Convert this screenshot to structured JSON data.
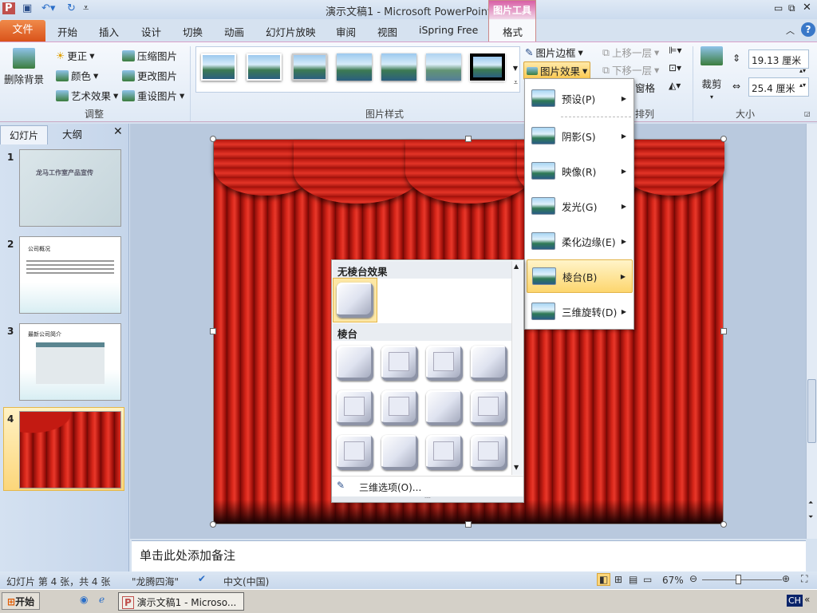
{
  "app": {
    "title": "演示文稿1 - Microsoft PowerPoint",
    "context_tab_group": "图片工具"
  },
  "tabs": {
    "file": "文件",
    "items": [
      "开始",
      "插入",
      "设计",
      "切换",
      "动画",
      "幻灯片放映",
      "审阅",
      "视图",
      "iSpring Free"
    ],
    "active": "格式"
  },
  "ribbon": {
    "remove_bg": "删除背景",
    "adjust": {
      "corrections": "更正",
      "color": "颜色",
      "artistic": "艺术效果",
      "compress": "压缩图片",
      "change": "更改图片",
      "reset": "重设图片",
      "label": "调整"
    },
    "styles": {
      "label": "图片样式",
      "border": "图片边框",
      "effects": "图片效果"
    },
    "arrange": {
      "forward": "上移一层",
      "backward": "下移一层",
      "pane": "窗格",
      "label": "排列"
    },
    "size": {
      "crop": "裁剪",
      "height": "19.13 厘米",
      "width": "25.4 厘米",
      "label": "大小"
    }
  },
  "panel": {
    "tabs": [
      "幻灯片",
      "大纲"
    ],
    "slides": [
      {
        "num": "1",
        "title": "龙马工作室产品宣传"
      },
      {
        "num": "2",
        "title": "公司概况"
      },
      {
        "num": "3",
        "title": "最新公司简介"
      },
      {
        "num": "4"
      }
    ]
  },
  "effects_menu": [
    {
      "label": "预设(P)"
    },
    {
      "label": "阴影(S)"
    },
    {
      "label": "映像(R)"
    },
    {
      "label": "发光(G)"
    },
    {
      "label": "柔化边缘(E)"
    },
    {
      "label": "棱台(B)",
      "highlighted": true
    },
    {
      "label": "三维旋转(D)"
    }
  ],
  "bevel_gallery": {
    "none_header": "无棱台效果",
    "bevel_header": "棱台",
    "options": "三维选项(O)...",
    "count": 12
  },
  "notes": "单击此处添加备注",
  "status": {
    "slide": "幻灯片 第 4 张，共 4 张",
    "theme": "\"龙腾四海\"",
    "lang": "中文(中国)",
    "zoom": "67%",
    "zoom_fraction": 0.45
  },
  "taskbar": {
    "start": "开始",
    "window": "演示文稿1 - Microso...",
    "ime": "CH"
  }
}
